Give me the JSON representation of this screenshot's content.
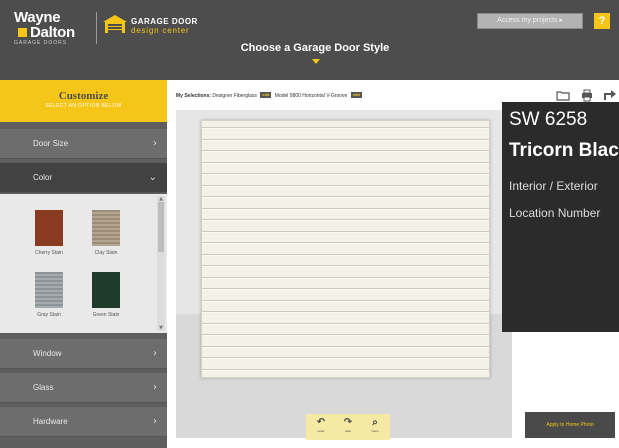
{
  "header": {
    "brand_line1": "Wayne",
    "brand_line2": "Dalton",
    "brand_tagline": "GARAGE DOORS",
    "gdc_line1": "GARAGE DOOR",
    "gdc_line2": "design center",
    "page_title": "Choose a Garage Door Style",
    "access_label": "Access my projects ▸",
    "help_label": "?",
    "accent_color": "#f5c518",
    "bg_color": "#4d4d4d"
  },
  "sidebar": {
    "customize_title": "Customize",
    "customize_subtitle": "SELECT AN OPTION BELOW",
    "items": [
      {
        "label": "Door Size",
        "chevron": "›"
      },
      {
        "label": "Color",
        "chevron": "⌄"
      },
      {
        "label": "Window",
        "chevron": "›"
      },
      {
        "label": "Glass",
        "chevron": "›"
      },
      {
        "label": "Hardware",
        "chevron": "›"
      }
    ],
    "swatches": [
      {
        "label": "Cherry Stain",
        "color": "#8a3b22"
      },
      {
        "label": "Clay Stain",
        "color": "#a99a86"
      },
      {
        "label": "Gray Stain",
        "color": "#9aa0a3"
      },
      {
        "label": "Green Stain",
        "color": "#1f3b2c"
      }
    ]
  },
  "main": {
    "selections_label": "My Selections:",
    "selection_door": "Designer Fiberglass",
    "selection_model": "Model 9800 Horizontal V-Groove",
    "tag_label": "edit",
    "toolbar_icons": [
      "folder-icon",
      "print-icon",
      "share-icon"
    ],
    "controls": [
      {
        "glyph": "↶",
        "label": "undo"
      },
      {
        "glyph": "↷",
        "label": "redo"
      },
      {
        "glyph": "⌕",
        "label": "zoom"
      }
    ],
    "apply_label": "Apply to Home Photo",
    "door_color": "#f4f1e8"
  },
  "tooltip": {
    "color_number": "SW 6258",
    "color_name": "Tricorn Black",
    "usage": "Interior / Exterior",
    "location": "Location Number"
  }
}
